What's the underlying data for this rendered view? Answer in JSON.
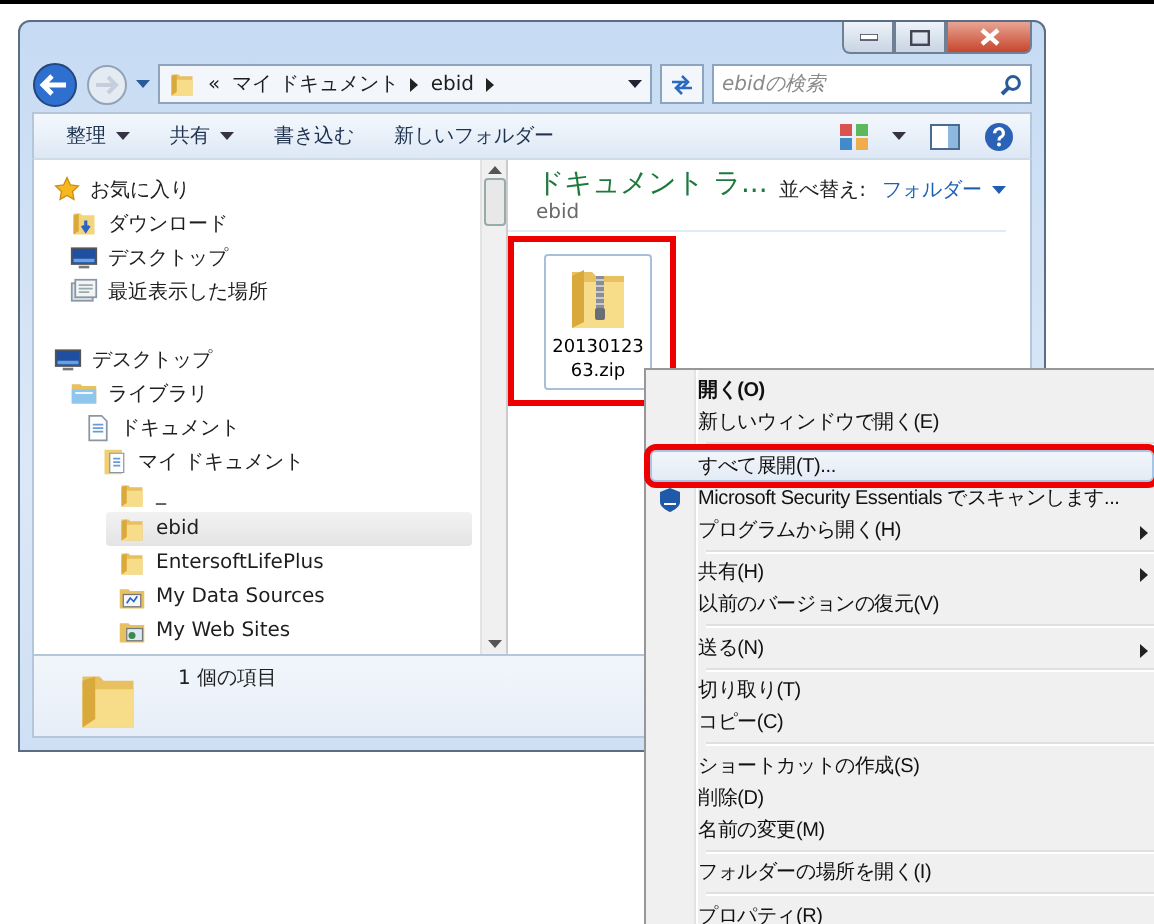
{
  "window": {
    "address": {
      "segments": [
        "«",
        "マイ ドキュメント",
        "ebid"
      ]
    },
    "search": {
      "placeholder": "ebidの検索"
    },
    "toolbar": [
      {
        "label": "整理",
        "dropdown": true
      },
      {
        "label": "共有",
        "dropdown": true
      },
      {
        "label": "書き込む",
        "dropdown": false
      },
      {
        "label": "新しいフォルダー",
        "dropdown": false
      }
    ],
    "sidebar": [
      {
        "label": "お気に入り",
        "kind": "star",
        "selected": false,
        "children": [
          {
            "label": "ダウンロード",
            "kind": "download",
            "selected": false
          },
          {
            "label": "デスクトップ",
            "kind": "desktop",
            "selected": false
          },
          {
            "label": "最近表示した場所",
            "kind": "recent",
            "selected": false
          }
        ]
      },
      {
        "label": "デスクトップ",
        "kind": "desktop",
        "selected": false,
        "children": [
          {
            "label": "ライブラリ",
            "kind": "library",
            "selected": false,
            "children": [
              {
                "label": "ドキュメント",
                "kind": "document",
                "selected": false,
                "children": [
                  {
                    "label": "マイ ドキュメント",
                    "kind": "docfolder",
                    "selected": false,
                    "children": [
                      {
                        "label": "_",
                        "kind": "folder",
                        "selected": false
                      },
                      {
                        "label": "ebid",
                        "kind": "folder",
                        "selected": true
                      },
                      {
                        "label": "EntersoftLifePlus",
                        "kind": "folder",
                        "selected": false
                      },
                      {
                        "label": "My Data Sources",
                        "kind": "datafolder",
                        "selected": false
                      },
                      {
                        "label": "My Web Sites",
                        "kind": "webfolder",
                        "selected": false
                      }
                    ]
                  }
                ]
              }
            ]
          }
        ]
      }
    ],
    "content": {
      "title": "ドキュメント ラ...",
      "subtitle": "ebid",
      "sort_label": "並べ替え:",
      "sort_value": "フォルダー",
      "files": [
        {
          "name": "2013012363.zip",
          "selected": true,
          "highlighted": true
        }
      ]
    },
    "status": {
      "text": "1 個の項目"
    }
  },
  "context_menu": {
    "groups": [
      [
        {
          "label": "開く(O)",
          "kind": "plain",
          "default": true,
          "submenu": false,
          "selected": false,
          "highlighted": false
        },
        {
          "label": "新しいウィンドウで開く(E)",
          "kind": "plain",
          "default": false,
          "submenu": false,
          "selected": false,
          "highlighted": false
        }
      ],
      [
        {
          "label": "すべて展開(T)...",
          "kind": "plain",
          "default": false,
          "submenu": false,
          "selected": true,
          "highlighted": true
        },
        {
          "label": "Microsoft Security Essentials でスキャンします...",
          "kind": "shield",
          "default": false,
          "submenu": false,
          "selected": false,
          "highlighted": false
        },
        {
          "label": "プログラムから開く(H)",
          "kind": "plain",
          "default": false,
          "submenu": true,
          "selected": false,
          "highlighted": false
        }
      ],
      [
        {
          "label": "共有(H)",
          "kind": "plain",
          "default": false,
          "submenu": true,
          "selected": false,
          "highlighted": false
        },
        {
          "label": "以前のバージョンの復元(V)",
          "kind": "plain",
          "default": false,
          "submenu": false,
          "selected": false,
          "highlighted": false
        }
      ],
      [
        {
          "label": "送る(N)",
          "kind": "plain",
          "default": false,
          "submenu": true,
          "selected": false,
          "highlighted": false
        }
      ],
      [
        {
          "label": "切り取り(T)",
          "kind": "plain",
          "default": false,
          "submenu": false,
          "selected": false,
          "highlighted": false
        },
        {
          "label": "コピー(C)",
          "kind": "plain",
          "default": false,
          "submenu": false,
          "selected": false,
          "highlighted": false
        }
      ],
      [
        {
          "label": "ショートカットの作成(S)",
          "kind": "plain",
          "default": false,
          "submenu": false,
          "selected": false,
          "highlighted": false
        },
        {
          "label": "削除(D)",
          "kind": "plain",
          "default": false,
          "submenu": false,
          "selected": false,
          "highlighted": false
        },
        {
          "label": "名前の変更(M)",
          "kind": "plain",
          "default": false,
          "submenu": false,
          "selected": false,
          "highlighted": false
        }
      ],
      [
        {
          "label": "フォルダーの場所を開く(I)",
          "kind": "plain",
          "default": false,
          "submenu": false,
          "selected": false,
          "highlighted": false
        }
      ],
      [
        {
          "label": "プロパティ(R)",
          "kind": "plain",
          "default": false,
          "submenu": false,
          "selected": false,
          "highlighted": false
        }
      ]
    ]
  }
}
